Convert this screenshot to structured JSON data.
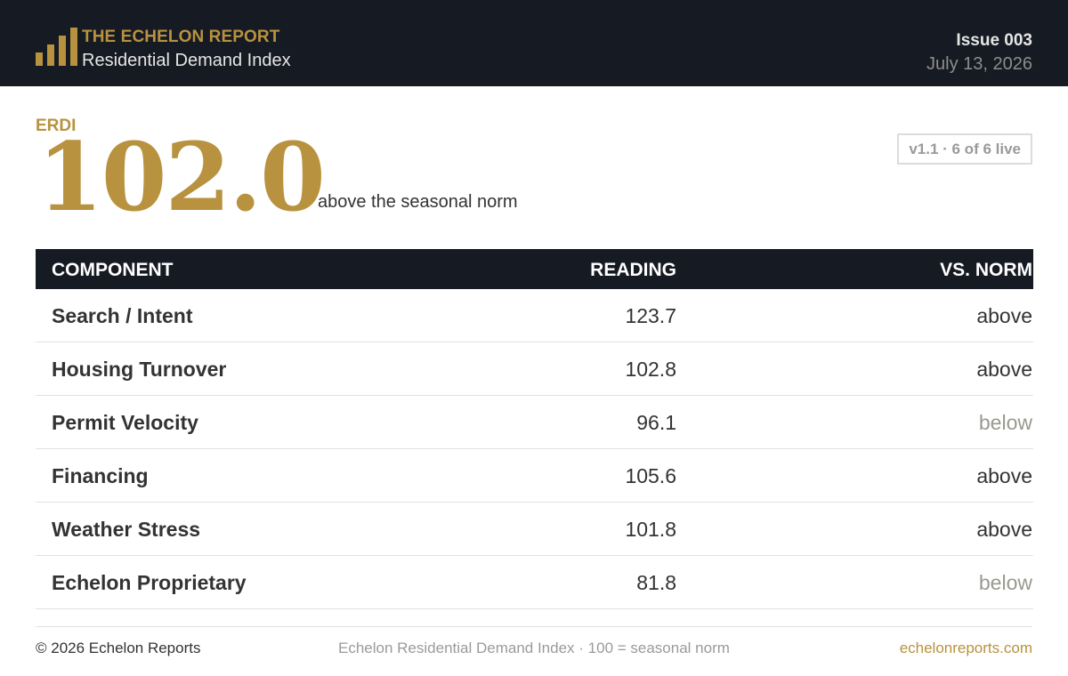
{
  "header": {
    "brand_title": "THE ECHELON REPORT",
    "brand_subtitle": "Residential Demand Index",
    "issue": "Issue 003",
    "date": "July 13, 2026",
    "logo_icon": "bar-chart-icon"
  },
  "kpi": {
    "label": "ERDI",
    "value": "102.0",
    "caption": "above the seasonal norm",
    "badge": "v1.1 · 6 of 6 live"
  },
  "table": {
    "headers": [
      "COMPONENT",
      "READING",
      "VS. NORM"
    ],
    "rows": [
      {
        "component": "Search / Intent",
        "reading": "123.7",
        "vs_norm": "above"
      },
      {
        "component": "Housing Turnover",
        "reading": "102.8",
        "vs_norm": "above"
      },
      {
        "component": "Permit Velocity",
        "reading": "96.1",
        "vs_norm": "below"
      },
      {
        "component": "Financing",
        "reading": "105.6",
        "vs_norm": "above"
      },
      {
        "component": "Weather Stress",
        "reading": "101.8",
        "vs_norm": "above"
      },
      {
        "component": "Echelon Proprietary",
        "reading": "81.8",
        "vs_norm": "below"
      }
    ]
  },
  "footer": {
    "copyright": "© 2026 Echelon Reports",
    "note": "Echelon Residential Demand Index · 100 = seasonal norm",
    "link": "echelonreports.com"
  },
  "colors": {
    "gold": "#b8923f",
    "header_bg": "#161a22",
    "muted": "#999990"
  }
}
